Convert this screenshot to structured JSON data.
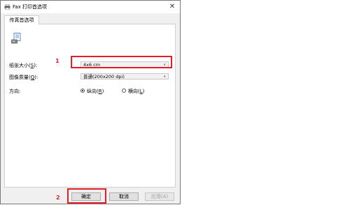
{
  "window": {
    "title": "Fax 打印首选项",
    "close_glyph": "✕"
  },
  "tabs": [
    {
      "label": "传真首选项"
    }
  ],
  "form": {
    "paper_size": {
      "label_text": "纸张大小(",
      "accel": "S",
      "label_tail": "):",
      "value": "4x6 cm"
    },
    "quality": {
      "label_text": "图像质量(",
      "accel": "Q",
      "label_tail": "):",
      "value": "普通(200x200 dpi)"
    },
    "orientation": {
      "label": "方向:",
      "portrait": {
        "text": "纵向(",
        "accel": "R",
        "tail": ")",
        "selected": true
      },
      "landscape": {
        "text": "横向(",
        "accel": "L",
        "tail": ")",
        "selected": false
      }
    }
  },
  "buttons": {
    "ok": "确定",
    "cancel": "取消",
    "apply": "应用(A)"
  },
  "annotations": {
    "marker1": "1",
    "marker2": "2",
    "highlight_color": "#e0202a"
  }
}
